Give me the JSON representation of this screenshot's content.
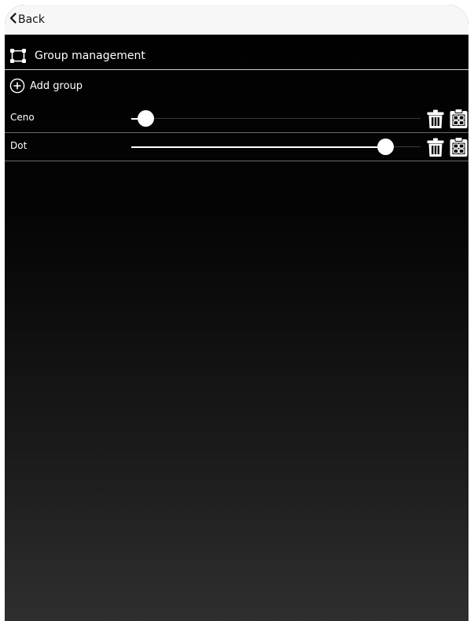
{
  "nav": {
    "back_label": "Back"
  },
  "header": {
    "title": "Group management"
  },
  "add_group": {
    "label": "Add group"
  },
  "groups": [
    {
      "name": "Ceno",
      "slider_value": 0.05
    },
    {
      "name": "Dot",
      "slider_value": 0.88
    }
  ],
  "icons": {
    "back": "chevron-left-icon",
    "header": "group-nodes-icon",
    "add": "plus-circle-icon",
    "delete": "trash-icon",
    "assign": "clipboard-grid-icon"
  },
  "colors": {
    "background": "#000000",
    "text": "#ffffff",
    "topbar": "#f7f7f7"
  }
}
